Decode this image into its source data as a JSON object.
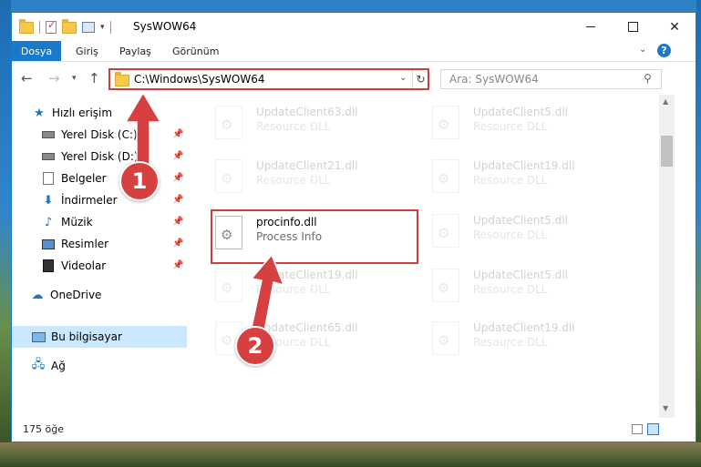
{
  "window": {
    "title": "SysWOW64"
  },
  "ribbon": {
    "tabs": [
      "Dosya",
      "Giriş",
      "Paylaş",
      "Görünüm"
    ],
    "help": "?"
  },
  "navbar": {
    "address": "C:\\Windows\\SysWOW64",
    "search_placeholder": "Ara: SysWOW64"
  },
  "sidebar": {
    "quick_access": "Hızlı erişim",
    "items": [
      {
        "label": "Yerel Disk (C:)",
        "icon": "drive-icon"
      },
      {
        "label": "Yerel Disk (D:)",
        "icon": "drive-icon"
      },
      {
        "label": "Belgeler",
        "icon": "documents-icon"
      },
      {
        "label": "İndirmeler",
        "icon": "downloads-icon"
      },
      {
        "label": "Müzik",
        "icon": "music-icon"
      },
      {
        "label": "Resimler",
        "icon": "pictures-icon"
      },
      {
        "label": "Videolar",
        "icon": "videos-icon"
      }
    ],
    "onedrive": "OneDrive",
    "this_pc": "Bu bilgisayar",
    "network": "Ağ"
  },
  "files": [
    {
      "name": "UpdateClient63.dll",
      "desc": "Resource DLL"
    },
    {
      "name": "UpdateClient5.dll",
      "desc": "Resource DLL"
    },
    {
      "name": "UpdateClient21.dll",
      "desc": "Resource DLL"
    },
    {
      "name": "UpdateClient19.dll",
      "desc": "Resource DLL"
    },
    {
      "name": "procinfo.dll",
      "desc": "Process Info"
    },
    {
      "name": "UpdateClient5.dll",
      "desc": "Resource DLL"
    },
    {
      "name": "UpdateClient19.dll",
      "desc": "Resource DLL"
    },
    {
      "name": "UpdateClient5.dll",
      "desc": "Resource DLL"
    },
    {
      "name": "UpdateClient65.dll",
      "desc": "Resource DLL"
    },
    {
      "name": "UpdateClient19.dll",
      "desc": "Resource DLL"
    }
  ],
  "status": {
    "count": "175 öğe"
  },
  "annotations": {
    "step1": "1",
    "step2": "2"
  },
  "colors": {
    "accent": "#1979ca",
    "highlight": "#d43c3c",
    "selected": "#cce8ff"
  }
}
